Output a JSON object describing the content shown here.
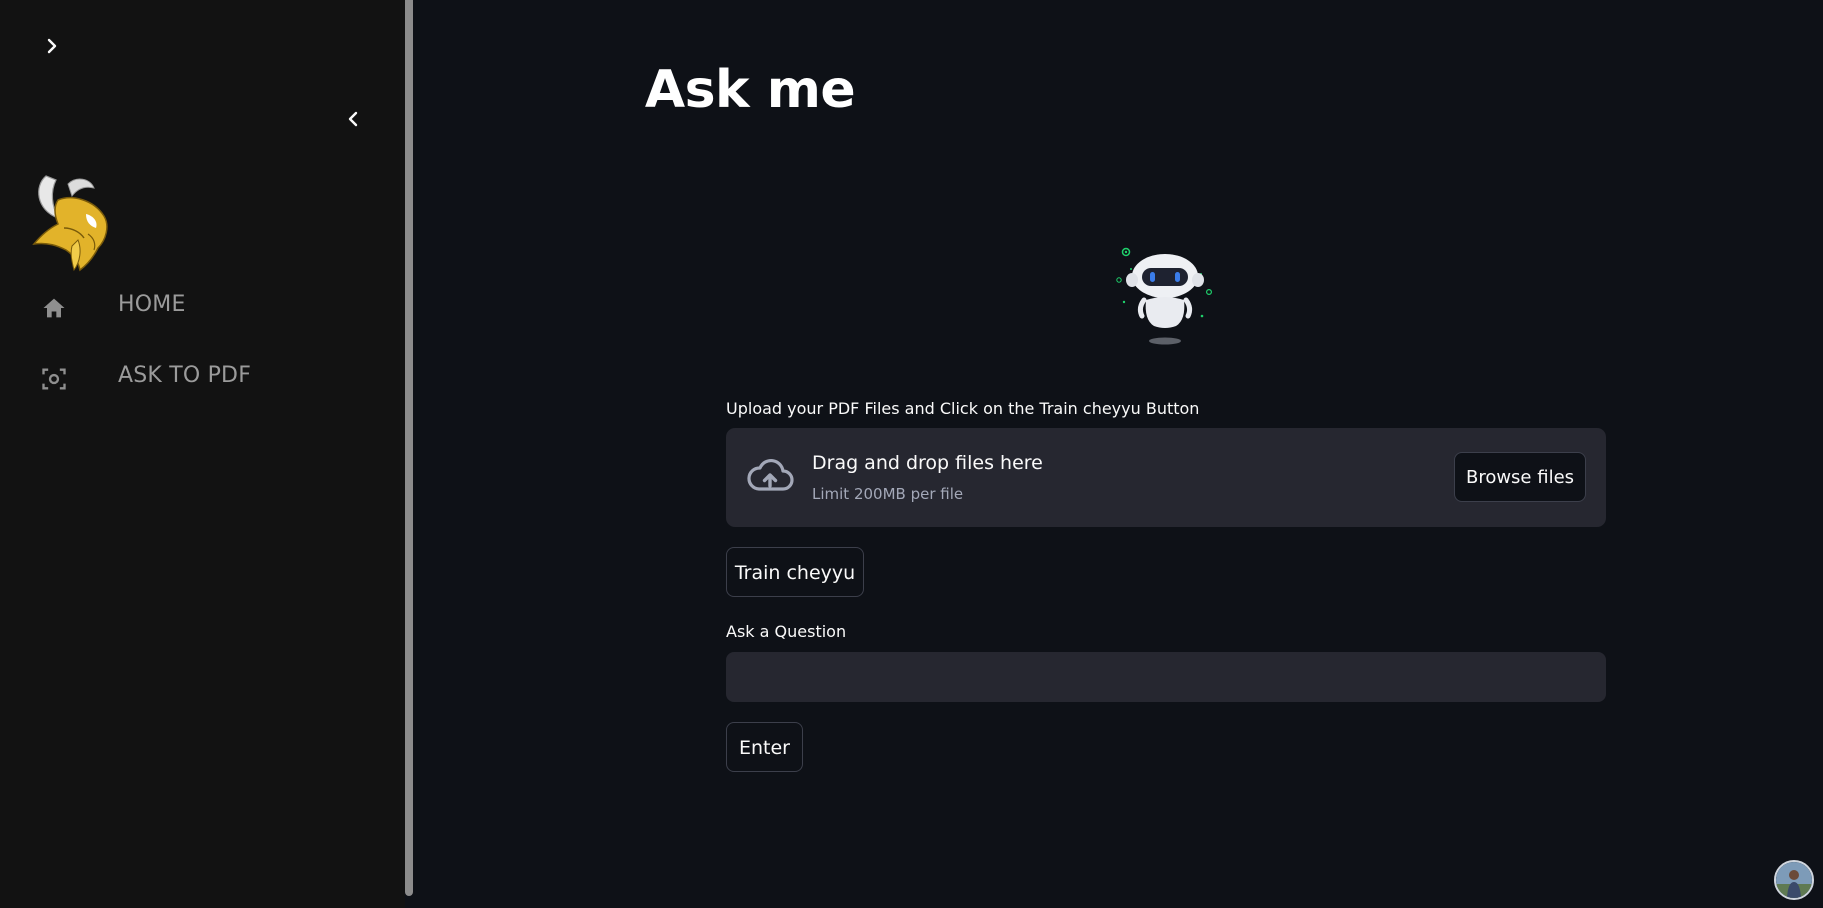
{
  "sidebar": {
    "expand_icon": "chevron-right-icon",
    "collapse_icon": "chevron-left-icon",
    "logo": "vikings-logo",
    "nav": [
      {
        "label": "HOME",
        "icon": "home-icon"
      },
      {
        "label": "ASK TO PDF",
        "icon": "scan-icon"
      }
    ]
  },
  "main": {
    "title": "Ask me",
    "hero_image": "robot-illustration",
    "upload": {
      "label": "Upload your PDF Files and Click on the Train cheyyu Button",
      "drag_text": "Drag and drop files here",
      "limit_text": "Limit 200MB per file",
      "browse_label": "Browse files",
      "icon": "cloud-upload-icon"
    },
    "train_label": "Train cheyyu",
    "question": {
      "label": "Ask a Question",
      "value": "",
      "placeholder": ""
    },
    "enter_label": "Enter"
  },
  "colors": {
    "background": "#0e1117",
    "sidebar": "#121212",
    "surface": "#262730",
    "accent_green": "#1fd16c",
    "robot_visor": "#2f6fe0"
  }
}
